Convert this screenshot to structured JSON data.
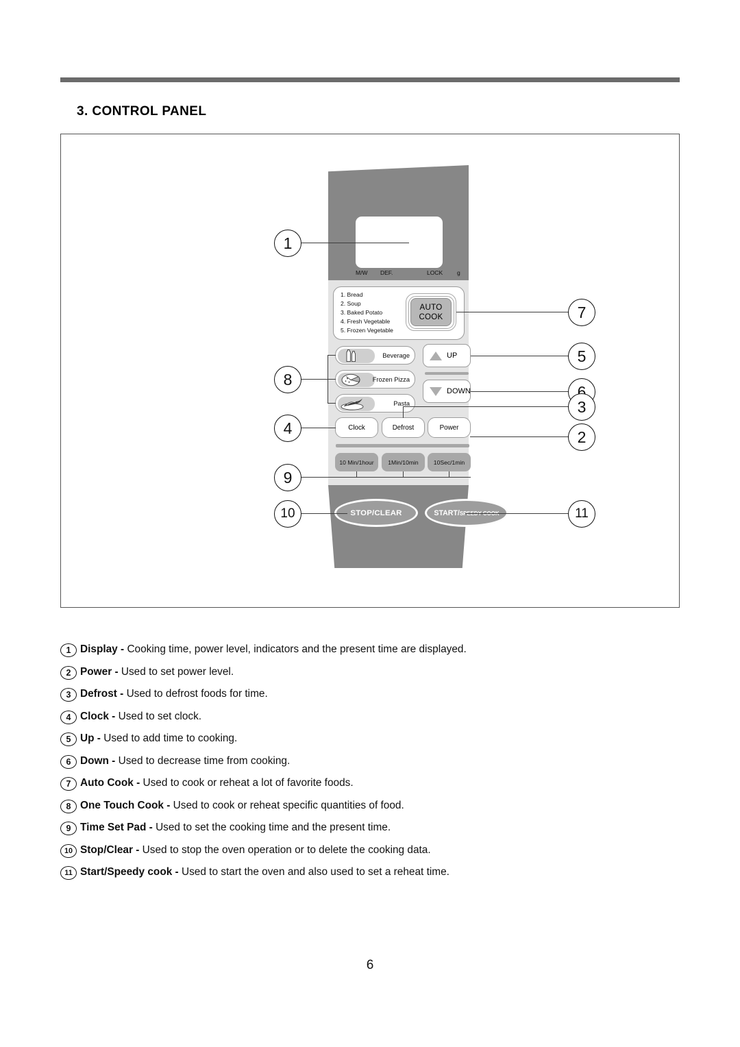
{
  "document": {
    "section_title": "3. CONTROL PANEL",
    "page_number": "6"
  },
  "panel": {
    "display": {
      "indicators": [
        "M/W",
        "DEF.",
        "LOCK",
        "g"
      ]
    },
    "auto_cook": {
      "button_line1": "AUTO",
      "button_line2": "COOK",
      "menu": [
        "1. Bread",
        "2. Soup",
        "3. Baked Potato",
        "4. Fresh Vegetable",
        "5. Frozen Vegetable"
      ]
    },
    "one_touch": [
      {
        "label": "Beverage",
        "icon": "bottles-icon"
      },
      {
        "label": "Frozen Pizza",
        "icon": "pizza-slice-icon"
      },
      {
        "label": "Pasta",
        "icon": "pasta-plate-icon"
      }
    ],
    "up_label": "UP",
    "down_label": "DOWN",
    "function_buttons": [
      "Clock",
      "Defrost",
      "Power"
    ],
    "time_pads": [
      "10 Min/1hour",
      "1Min/10min",
      "10Sec/1min"
    ],
    "stop_label": "STOP/CLEAR",
    "start_label_main": "START/",
    "start_label_small": "SPEEDY COOK"
  },
  "callouts": [
    "1",
    "2",
    "3",
    "4",
    "5",
    "6",
    "7",
    "8",
    "9",
    "10",
    "11"
  ],
  "descriptions": [
    {
      "num": "1",
      "term": "Display - ",
      "text": "Cooking time, power level, indicators and the present time are displayed."
    },
    {
      "num": "2",
      "term": "Power - ",
      "text": "Used to set power level."
    },
    {
      "num": "3",
      "term": "Defrost - ",
      "text": "Used to defrost foods for time."
    },
    {
      "num": "4",
      "term": "Clock - ",
      "text": "Used to set clock."
    },
    {
      "num": "5",
      "term": "Up - ",
      "text": "Used to add time to cooking."
    },
    {
      "num": "6",
      "term": "Down - ",
      "text": "Used to decrease time from cooking."
    },
    {
      "num": "7",
      "term": "Auto Cook - ",
      "text": "Used to cook or reheat a lot of favorite foods."
    },
    {
      "num": "8",
      "term": "One Touch Cook - ",
      "text": "Used to cook or reheat specific quantities of food."
    },
    {
      "num": "9",
      "term": "Time Set Pad - ",
      "text": "Used to set the cooking time and the present time."
    },
    {
      "num": "10",
      "term": "Stop/Clear - ",
      "text": "Used to stop the oven operation or to delete the cooking data."
    },
    {
      "num": "11",
      "term": "Start/Speedy cook - ",
      "text": "Used to start the oven and also used to set a reheat time."
    }
  ]
}
